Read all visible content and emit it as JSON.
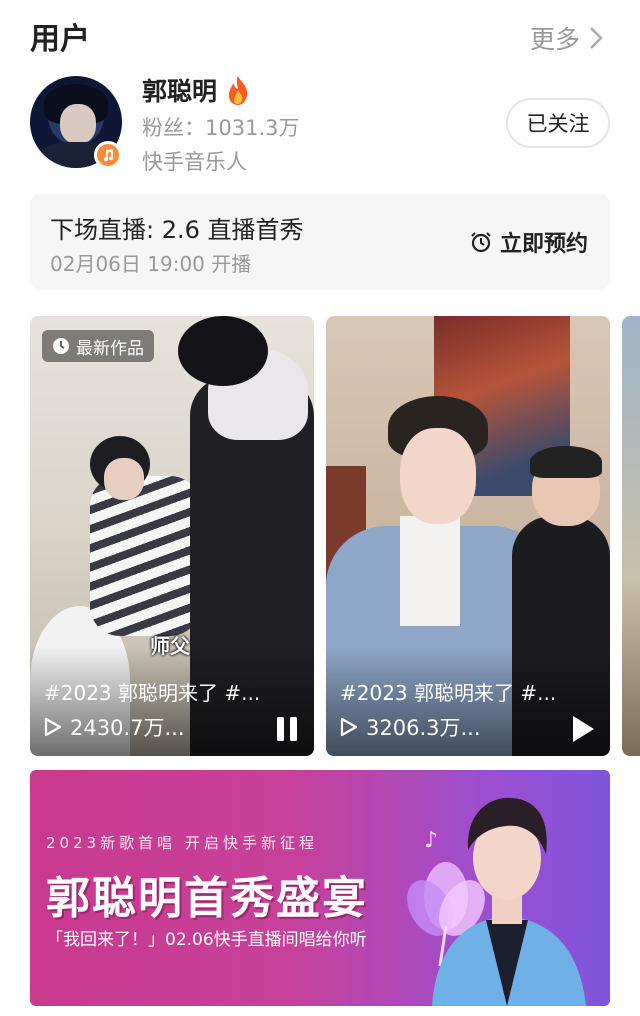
{
  "header": {
    "title": "用户",
    "more_label": "更多"
  },
  "user": {
    "name": "郭聪明",
    "fans": "粉丝：1031.3万",
    "tag": "快手音乐人",
    "follow_label": "已关注"
  },
  "live": {
    "title": "下场直播: 2.6 直播首秀",
    "time": "02月06日 19:00 开播",
    "reserve_label": "立即预约"
  },
  "videos": [
    {
      "badge": "最新作品",
      "caption": "#2023 郭聪明来了 #...",
      "views": "2430.7万...",
      "subtitle": "师父",
      "control": "pause"
    },
    {
      "caption": "#2023 郭聪明来了 #...",
      "views": "3206.3万...",
      "control": "play"
    }
  ],
  "banner": {
    "subtitle": "2023新歌首唱   开启快手新征程",
    "title": "郭聪明首秀盛宴",
    "footer": "「我回来了！」02.06快手直播间唱给你听"
  },
  "colors": {
    "accent_orange": "#ff8a3d",
    "banner_pink": "#c93a8e",
    "banner_purple": "#7f55db",
    "muted_text": "#999999"
  },
  "icons": [
    "chevron-right-icon",
    "fire-icon",
    "music-note-icon",
    "alarm-clock-icon",
    "clock-icon",
    "play-icon",
    "pause-icon"
  ]
}
